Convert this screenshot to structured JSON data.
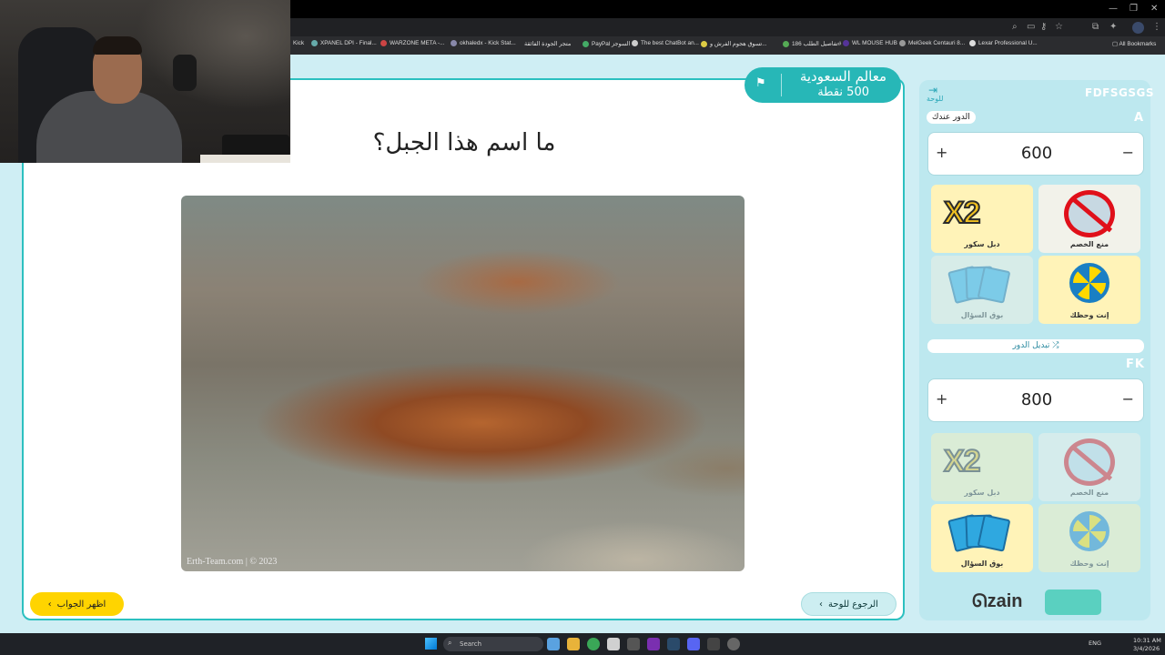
{
  "browser": {
    "bookmarks": [
      "Kick",
      "XPANEL DPI - Final...",
      "WARZONE META -...",
      "okhaledx - Kick Stat...",
      "متجر الجودة الفائقة",
      "PayPal السوجز",
      "The best ChatBot an...",
      "تسوق هجوم الفرش و...",
      "تفاصيل الطلب 186#",
      "WL MOUSE HUB",
      "MelGeek Centauri 8...",
      "Lexar Professional U..."
    ],
    "all_bookmarks": "All Bookmarks"
  },
  "question": {
    "category": "معالم السعودية",
    "points": "500 نقطة",
    "text": "ما اسم هذا الجبل؟",
    "image_credit": "Erth-Team.com | © 2023",
    "show_answer": "اظهر الجواب",
    "back_to_board": "الرجوع للوحة"
  },
  "sidebar": {
    "board_label": "للوحة",
    "switch_turn": "تبديل الدور",
    "teams": [
      {
        "name": "FDFSGSGS",
        "letter": "A",
        "turn_label": "الدور عندك",
        "score": "600",
        "aids": [
          "منع الخصم",
          "دبل سكور",
          "إنت وحظك",
          "بوق السؤال"
        ]
      },
      {
        "name": "FK",
        "score": "800",
        "aids": [
          "منع الخصم",
          "دبل سكور",
          "إنت وحظك",
          "بوق السؤال"
        ]
      }
    ],
    "x2_text": "X2",
    "zain": "zain"
  },
  "taskbar": {
    "search": "Search",
    "lang": "ENG",
    "time": "10:31 AM",
    "date": "3/4/2026"
  }
}
